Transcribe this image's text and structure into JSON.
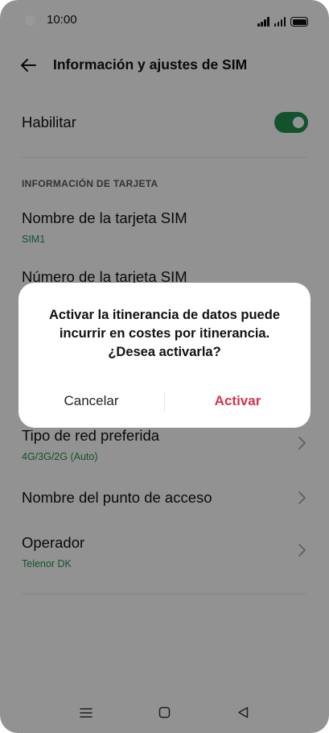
{
  "status_bar": {
    "time": "10:00"
  },
  "header": {
    "back_icon": "arrow-left-icon",
    "title": "Información y ajustes de SIM"
  },
  "enable": {
    "label": "Habilitar",
    "toggle_on": true,
    "toggle_color": "#1f8a4c"
  },
  "card_section": {
    "header": "INFORMACIÓN DE TARJETA",
    "items": [
      {
        "title": "Nombre de la tarjeta SIM",
        "subtitle": "SIM1"
      },
      {
        "title": "Número de la tarjeta SIM",
        "subtitle": ""
      }
    ]
  },
  "network_items": [
    {
      "title": "Tipo de red preferida",
      "subtitle": "4G/3G/2G (Auto)",
      "chevron": "chevron-right-icon"
    },
    {
      "title": "Nombre del punto de acceso",
      "subtitle": "",
      "chevron": "chevron-right-icon"
    },
    {
      "title": "Operador",
      "subtitle": "Telenor DK",
      "chevron": "chevron-right-icon"
    }
  ],
  "dialog": {
    "message": "Activar la itinerancia de datos puede incurrir en costes por itinerancia. ¿Desea activarla?",
    "cancel_label": "Cancelar",
    "confirm_label": "Activar",
    "confirm_color": "#d7324b"
  },
  "nav_bar": {
    "icons": [
      "menu-icon",
      "home-square-icon",
      "back-triangle-icon"
    ]
  },
  "colors": {
    "accent_green": "#1f8a4c",
    "scrim": "rgba(0,0,0,0.40)"
  }
}
